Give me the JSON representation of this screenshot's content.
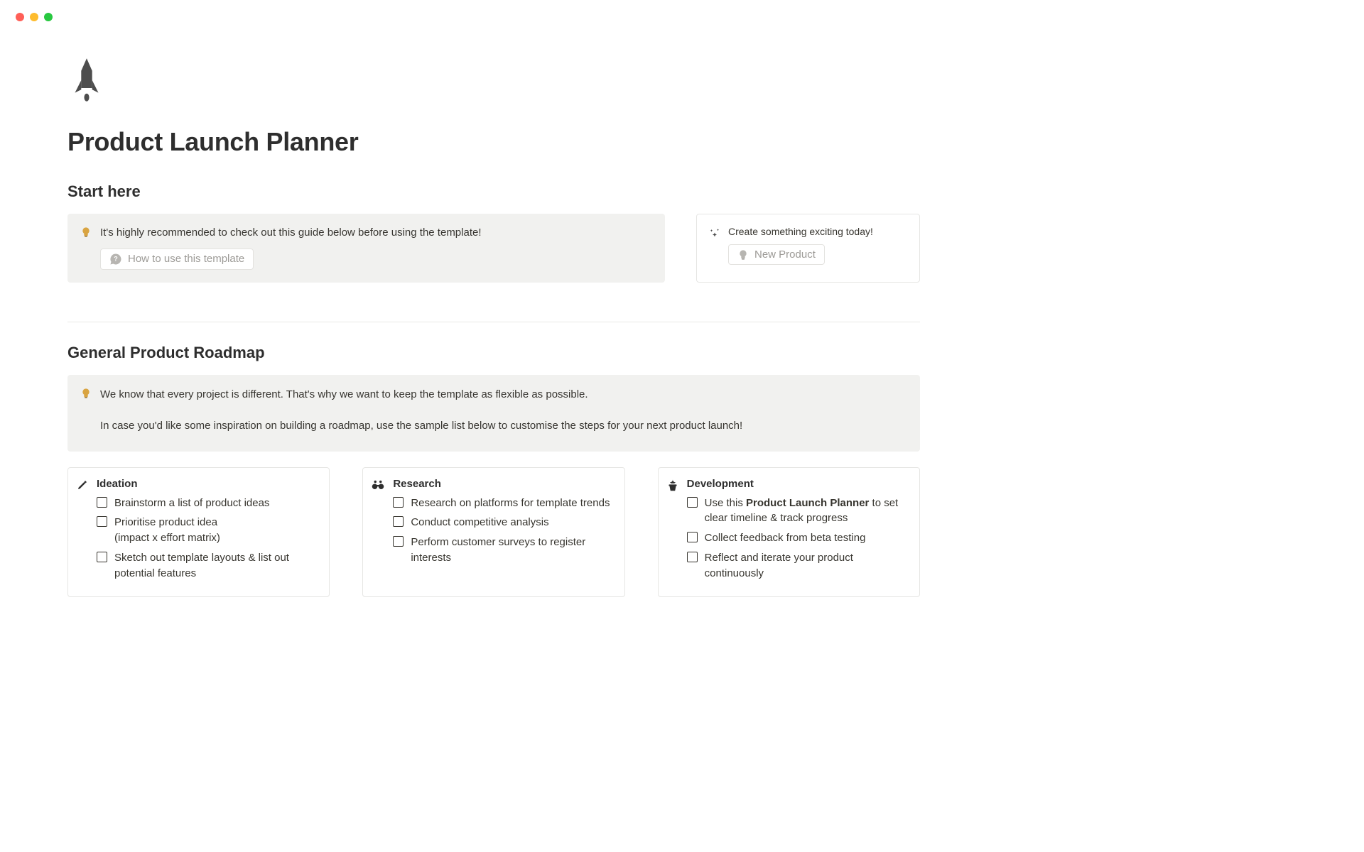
{
  "page": {
    "title": "Product Launch Planner"
  },
  "start": {
    "heading": "Start here",
    "tip_text": "It's highly recommended to check out this guide below before using the template!",
    "how_to_label": "How to use this template",
    "side_text": "Create something exciting today!",
    "new_product_label": "New Product"
  },
  "roadmap": {
    "heading": "General Product Roadmap",
    "callout_p1": "We know that every project is different. That's why we want to keep the template as flexible as possible.",
    "callout_p2": "In case you'd like some inspiration on building a roadmap, use the sample list below to customise the steps for your next product launch!",
    "columns": [
      {
        "title": "Ideation",
        "items": [
          {
            "text": "Brainstorm a list of product ideas"
          },
          {
            "text": "Prioritise product idea\n(impact x effort matrix)"
          },
          {
            "text": "Sketch out template layouts & list out potential features"
          }
        ]
      },
      {
        "title": "Research",
        "items": [
          {
            "text": "Research on platforms for template trends"
          },
          {
            "text": "Conduct competitive analysis"
          },
          {
            "text": "Perform customer surveys to register interests"
          }
        ]
      },
      {
        "title": "Development",
        "items": [
          {
            "text_before": "Use this ",
            "bold": "Product Launch Planner",
            "text_after": " to set clear timeline & track progress"
          },
          {
            "text": "Collect feedback from beta testing"
          },
          {
            "text": "Reflect and iterate your product continuously"
          }
        ]
      }
    ]
  }
}
